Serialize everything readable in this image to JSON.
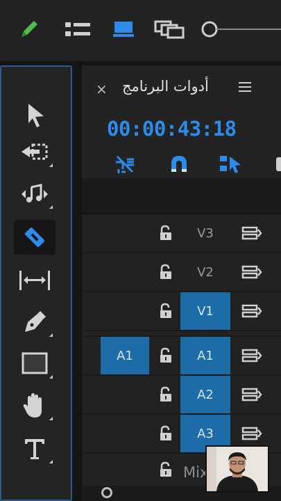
{
  "colors": {
    "accent": "#2d8ceb",
    "track_on": "#1d6ca8",
    "green": "#4cc14c"
  },
  "toolbar": {
    "icons": [
      "pencil-icon",
      "list-view-icon",
      "monitor-icon",
      "stacked-frames-icon",
      "zoom-slider-icon"
    ]
  },
  "tools": {
    "items": [
      {
        "name": "selection-tool-icon"
      },
      {
        "name": "track-select-forward-icon"
      },
      {
        "name": "ripple-edit-icon"
      },
      {
        "name": "razor-tool-icon",
        "selected": true
      },
      {
        "name": "slip-tool-icon"
      },
      {
        "name": "pen-tool-icon"
      },
      {
        "name": "rectangle-tool-icon"
      },
      {
        "name": "hand-tool-icon"
      },
      {
        "name": "type-tool-icon"
      }
    ]
  },
  "timeline": {
    "close": "×",
    "title": "أدوات البرنامج",
    "timecode": "00:00:43:18",
    "tools": [
      "snap-nest-icon",
      "magnet-icon",
      "linked-selection-icon"
    ],
    "tracks": [
      {
        "label": "V3",
        "active": false
      },
      {
        "label": "V2",
        "active": false
      },
      {
        "label": "V1",
        "active": true
      },
      {
        "label": "A1",
        "active": true,
        "source": "A1"
      },
      {
        "label": "A2",
        "active": true
      },
      {
        "label": "A3",
        "active": true
      }
    ],
    "mix_label": "Mix"
  }
}
